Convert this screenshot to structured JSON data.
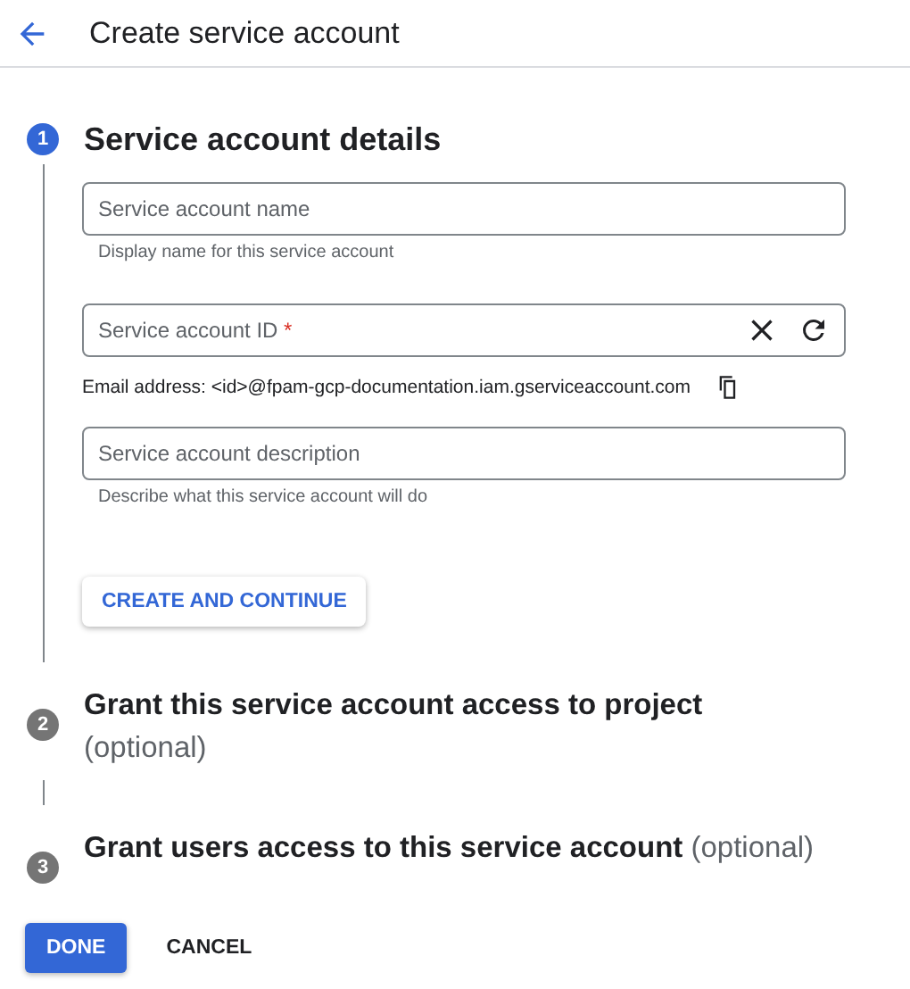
{
  "header": {
    "title": "Create service account"
  },
  "steps": [
    {
      "number": "1",
      "title": "Service account details",
      "selected": true
    },
    {
      "number": "2",
      "title": "Grant this service account access to project",
      "optional": "(optional)",
      "selected": false
    },
    {
      "number": "3",
      "title": "Grant users access to this service account",
      "optional": "(optional)",
      "selected": false
    }
  ],
  "fields": [
    {
      "kind": "plain",
      "placeholder": "Service account name",
      "hint": "Display name for this service account"
    },
    {
      "kind": "generated",
      "placeholder": "Service account ID",
      "required_mark": "*"
    },
    {
      "kind": "plain",
      "placeholder": "Service account description",
      "hint": "Describe what this service account will do"
    }
  ],
  "email": {
    "text": "Email address: <id>@fpam-gcp-documentation.iam.gserviceaccount.com"
  },
  "continue_button": "CREATE AND CONTINUE",
  "buttons": [
    {
      "label": "DONE",
      "kind": "primary"
    },
    {
      "label": "CANCEL",
      "kind": "text"
    }
  ]
}
